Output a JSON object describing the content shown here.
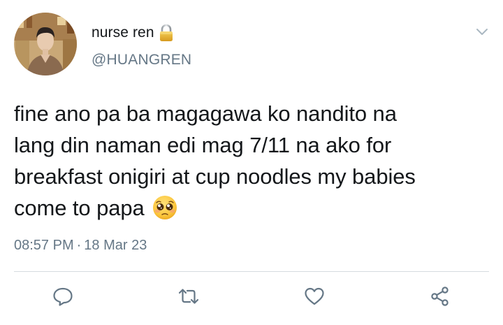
{
  "tweet": {
    "display_name": "nurse ren",
    "handle": "@HUANGREN",
    "lines": [
      "fine ano pa ba magagawa ko nandito na",
      "lang din naman edi mag 7/11 na ako for",
      "breakfast onigiri at cup noodles my babies",
      "come to papa"
    ],
    "time": "08:57 PM",
    "separator": "·",
    "date": "18 Mar 23"
  },
  "icons": {
    "protected": "lock-icon",
    "menu": "chevron-down-icon",
    "emoji": "pleading-face-emoji",
    "reply": "reply-icon",
    "retweet": "retweet-icon",
    "like": "heart-icon",
    "share": "share-icon"
  },
  "colors": {
    "text": "#14171a",
    "secondary": "#657786",
    "icon": "#657786",
    "divider": "#d6dbe0"
  }
}
